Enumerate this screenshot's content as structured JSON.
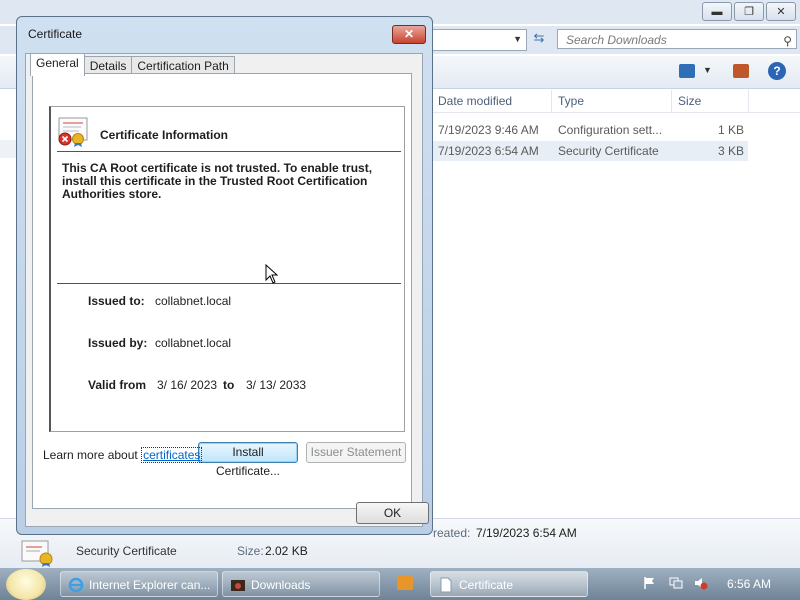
{
  "explorer": {
    "search_placeholder": "Search Downloads",
    "columns": [
      "Date modified",
      "Type",
      "Size"
    ],
    "files": [
      {
        "date": "7/19/2023 9:46 AM",
        "type": "Configuration sett...",
        "size": "1 KB",
        "selected": false
      },
      {
        "date": "7/19/2023 6:54 AM",
        "type": "Security Certificate",
        "size": "3 KB",
        "selected": true
      }
    ],
    "details": {
      "type": "Security Certificate",
      "size_label": "Size:",
      "size_value": "2.02 KB",
      "created_label": "reated:",
      "created_value": "7/19/2023 6:54 AM"
    }
  },
  "dialog": {
    "title": "Certificate",
    "tabs": [
      "General",
      "Details",
      "Certification Path"
    ],
    "info_title": "Certificate Information",
    "message": "This CA Root certificate is not trusted. To enable trust, install this certificate in the Trusted Root Certification Authorities store.",
    "issued_to_label": "Issued to:",
    "issued_to": "collabnet.local",
    "issued_by_label": "Issued by:",
    "issued_by": "collabnet.local",
    "valid_from_label": "Valid from",
    "valid_from": "3/ 16/ 2023",
    "to_label": "to",
    "valid_to": "3/ 13/ 2033",
    "install_button": "Install Certificate...",
    "issuer_button": "Issuer Statement",
    "learn_prefix": "Learn more about ",
    "learn_link": "certificates",
    "ok_button": "OK"
  },
  "taskbar": {
    "items": [
      "Internet Explorer can...",
      "Downloads",
      "Certificate"
    ],
    "clock": "6:56 AM"
  }
}
